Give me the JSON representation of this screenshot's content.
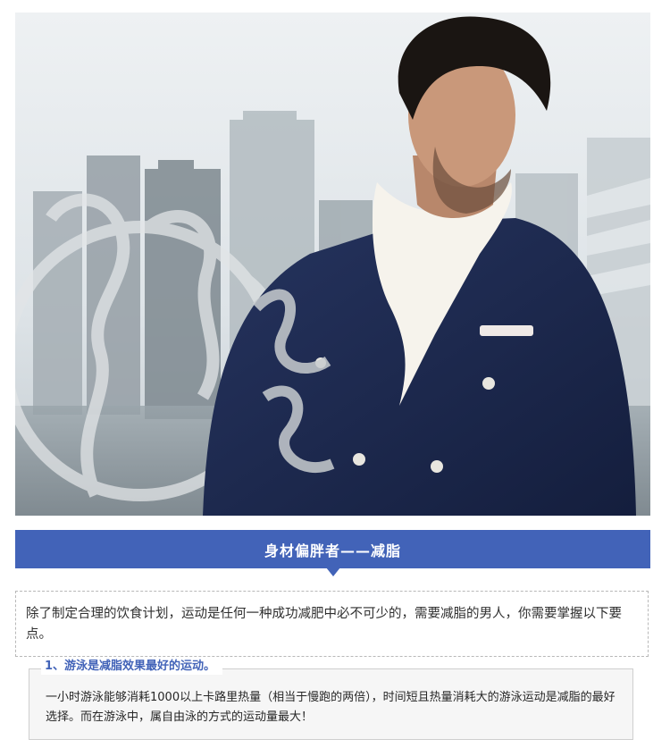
{
  "hero": {
    "image_description": "",
    "colors": {
      "sky": "#e9edf0",
      "suit": "#1c2a52",
      "scarf": "#f6f3ec",
      "buildings": "#8c979e",
      "emblem": "#c8cccf"
    }
  },
  "section": {
    "title": "身材偏胖者——减脂",
    "accent_color": "#4263b8"
  },
  "intro": {
    "text": "除了制定合理的饮食计划，运动是任何一种成功减肥中必不可少的，需要减脂的男人，你需要掌握以下要点。"
  },
  "tip": {
    "heading": "1、游泳是减脂效果最好的运动。",
    "text": "一小时游泳能够消耗1000以上卡路里热量（相当于慢跑的两倍），时间短且热量消耗大的游泳运动是减脂的最好选择。而在游泳中，属自由泳的方式的运动量最大！"
  }
}
